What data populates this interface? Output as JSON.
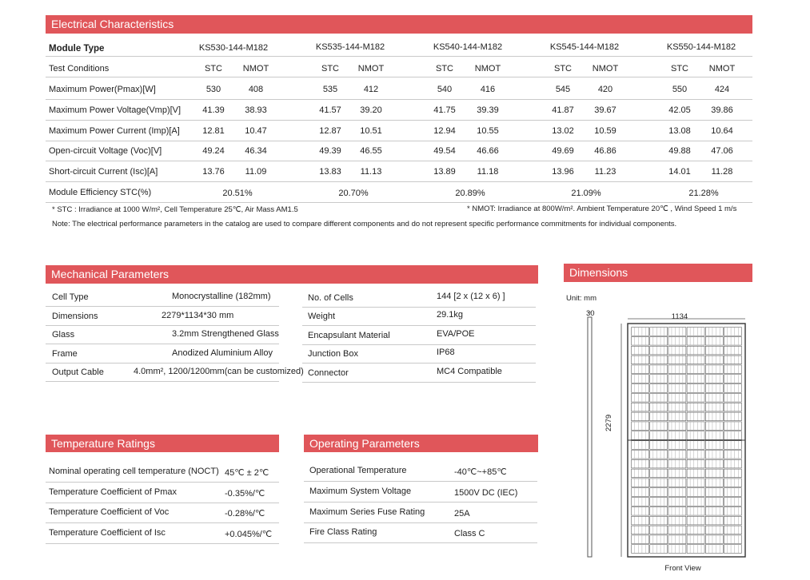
{
  "electrical": {
    "title": "Electrical Characteristics",
    "module_type_label": "Module Type",
    "models": [
      "KS530-144-M182",
      "KS535-144-M182",
      "KS540-144-M182",
      "KS545-144-M182",
      "KS550-144-M182"
    ],
    "test_conditions_label": "Test Conditions",
    "stc": "STC",
    "nmot": "NMOT",
    "rows": [
      {
        "label": "Maximum Power(Pmax)[W]",
        "values": [
          "530",
          "408",
          "535",
          "412",
          "540",
          "416",
          "545",
          "420",
          "550",
          "424"
        ]
      },
      {
        "label": "Maximum Power Voltage(Vmp)[V]",
        "values": [
          "41.39",
          "38.93",
          "41.57",
          "39.20",
          "41.75",
          "39.39",
          "41.87",
          "39.67",
          "42.05",
          "39.86"
        ]
      },
      {
        "label": "Maximum Power Current (Imp)[A]",
        "values": [
          "12.81",
          "10.47",
          "12.87",
          "10.51",
          "12.94",
          "10.55",
          "13.02",
          "10.59",
          "13.08",
          "10.64"
        ]
      },
      {
        "label": "Open-circuit Voltage (Voc)[V]",
        "values": [
          "49.24",
          "46.34",
          "49.39",
          "46.55",
          "49.54",
          "46.66",
          "49.69",
          "46.86",
          "49.88",
          "47.06"
        ]
      },
      {
        "label": "Short-circuit Current (Isc)[A]",
        "values": [
          "13.76",
          "11.09",
          "13.83",
          "11.13",
          "13.89",
          "11.18",
          "13.96",
          "11.23",
          "14.01",
          "11.28"
        ]
      }
    ],
    "efficiency_label": "Module Efficiency STC(%)",
    "efficiency": [
      "20.51%",
      "20.70%",
      "20.89%",
      "21.09%",
      "21.28%"
    ],
    "stc_note": "* STC : Irradiance at 1000 W/m², Cell Temperature 25℃, Air Mass AM1.5",
    "nmot_note": "* NMOT: Irradiance at 800W/m². Ambient Temperature 20℃ , Wind Speed 1 m/s",
    "note": "Note: The electrical performance parameters in the catalog are used to compare different components and do not represent specific performance commitments for individual components."
  },
  "mechanical": {
    "title": "Mechanical Parameters",
    "left": [
      {
        "label": "Cell Type",
        "value": "Monocrystalline (182mm)"
      },
      {
        "label": "Dimensions",
        "value": "2279*1134*30 mm"
      },
      {
        "label": "Glass",
        "value": "3.2mm Strengthened Glass"
      },
      {
        "label": "Frame",
        "value": "Anodized Aluminium Alloy"
      },
      {
        "label": "Output Cable",
        "value": "4.0mm², 1200/1200mm(can be customized)"
      }
    ],
    "right": [
      {
        "label": "No. of Cells",
        "value": "144 [2 x (12 x 6) ]"
      },
      {
        "label": "Weight",
        "value": "29.1kg"
      },
      {
        "label": "Encapsulant Material",
        "value": "EVA/POE"
      },
      {
        "label": "Junction Box",
        "value": "IP68"
      },
      {
        "label": "Connector",
        "value": "MC4 Compatible"
      }
    ]
  },
  "dimensions": {
    "title": "Dimensions",
    "unit": "Unit:  mm",
    "thickness": "30",
    "width": "1134",
    "height": "2279",
    "caption": "Front View"
  },
  "temperature": {
    "title": "Temperature Ratings",
    "rows": [
      {
        "label": "Nominal operating cell temperature (NOCT)",
        "value": "45℃ ± 2℃"
      },
      {
        "label": "Temperature Coefficient of Pmax",
        "value": "-0.35%/℃"
      },
      {
        "label": "Temperature Coefficient of Voc",
        "value": "-0.28%/℃"
      },
      {
        "label": "Temperature Coefficient of Isc",
        "value": "+0.045%/℃"
      }
    ]
  },
  "operating": {
    "title": "Operating Parameters",
    "rows": [
      {
        "label": "Operational Temperature",
        "value": "-40℃~+85℃"
      },
      {
        "label": "Maximum System Voltage",
        "value": "1500V DC (IEC)"
      },
      {
        "label": "Maximum  Series Fuse Rating",
        "value": "25A"
      },
      {
        "label": "Fire Class Rating",
        "value": "Class C"
      }
    ]
  }
}
